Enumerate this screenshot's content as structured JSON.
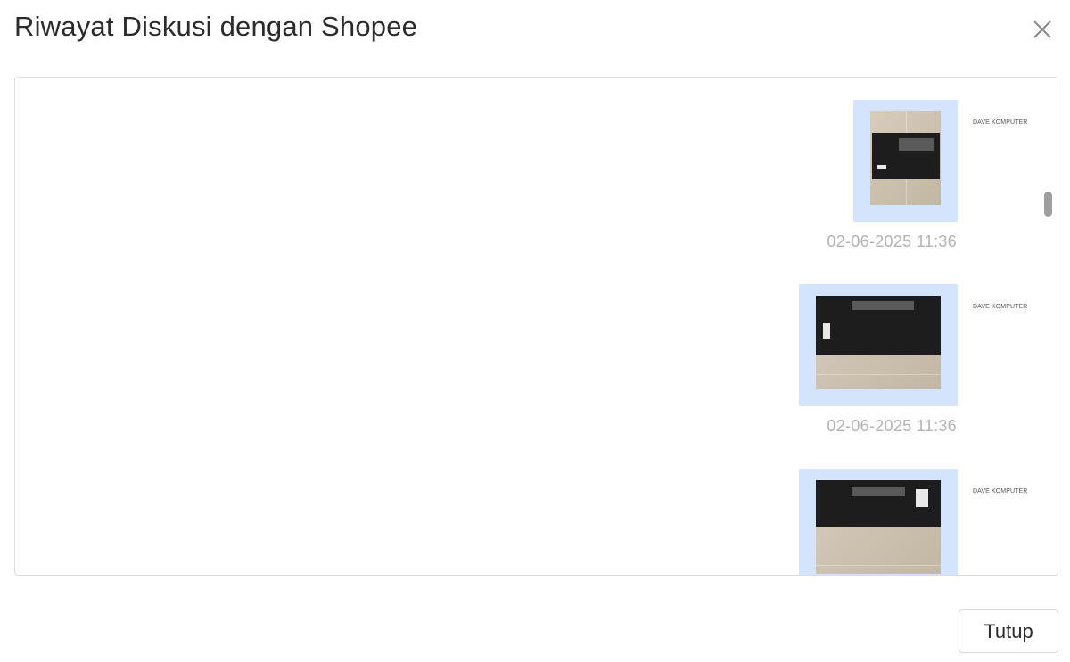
{
  "modal": {
    "title": "Riwayat Diskusi dengan Shopee",
    "close_icon": "close-icon",
    "footer": {
      "close_label": "Tutup"
    }
  },
  "messages": [
    {
      "sender": "DAVE KOMPUTER",
      "attachment": "image",
      "timestamp": "02-06-2025 11:36"
    },
    {
      "sender": "DAVE KOMPUTER",
      "attachment": "image",
      "timestamp": "02-06-2025 11:36"
    },
    {
      "sender": "DAVE KOMPUTER",
      "attachment": "image",
      "timestamp": ""
    }
  ],
  "colors": {
    "bubble": "#d4e4fd",
    "timestamp": "#b3b3b3",
    "border": "#dcdcdc",
    "scrollbar": "#9e9e9e"
  }
}
